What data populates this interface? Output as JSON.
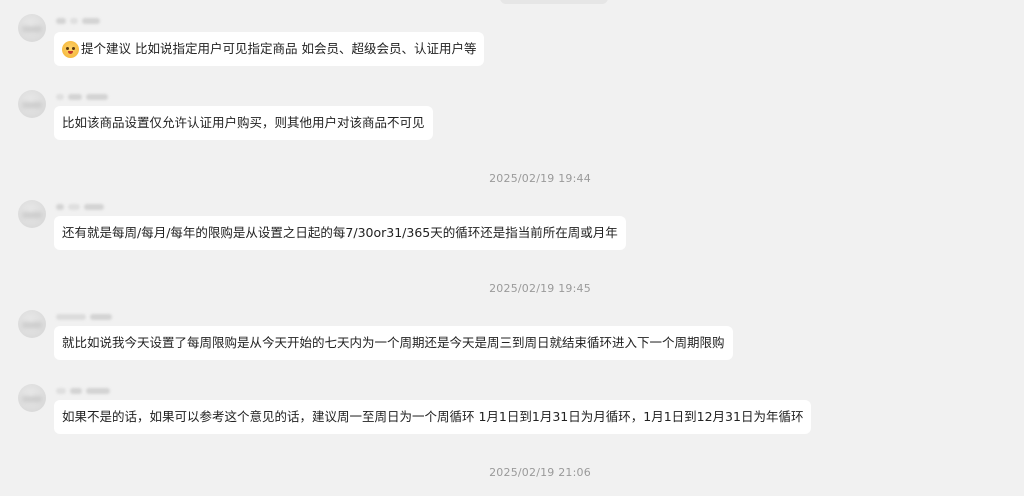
{
  "messages": [
    {
      "text": "提个建议 比如说指定用户可见指定商品 如会员、超级会员、认证用户等",
      "has_emoji": true
    },
    {
      "text": "比如该商品设置仅允许认证用户购买，则其他用户对该商品不可见"
    },
    {
      "text": "还有就是每周/每月/每年的限购是从设置之日起的每7/30or31/365天的循环还是指当前所在周或月年"
    },
    {
      "text": "就比如说我今天设置了每周限购是从今天开始的七天内为一个周期还是今天是周三到周日就结束循环进入下一个周期限购"
    },
    {
      "text": "如果不是的话，如果可以参考这个意见的话，建议周一至周日为一个周循环 1月1日到1月31日为月循环，1月1日到12月31日为年循环"
    }
  ],
  "timestamps": [
    "2025/02/19 19:44",
    "2025/02/19 19:45",
    "2025/02/19 21:06"
  ],
  "colors": {
    "background": "#f1f1f1",
    "bubble": "#ffffff",
    "text": "#222222",
    "timestamp": "#9a9a9a"
  },
  "icons": {
    "emoji": "smiley-emoji-icon"
  }
}
